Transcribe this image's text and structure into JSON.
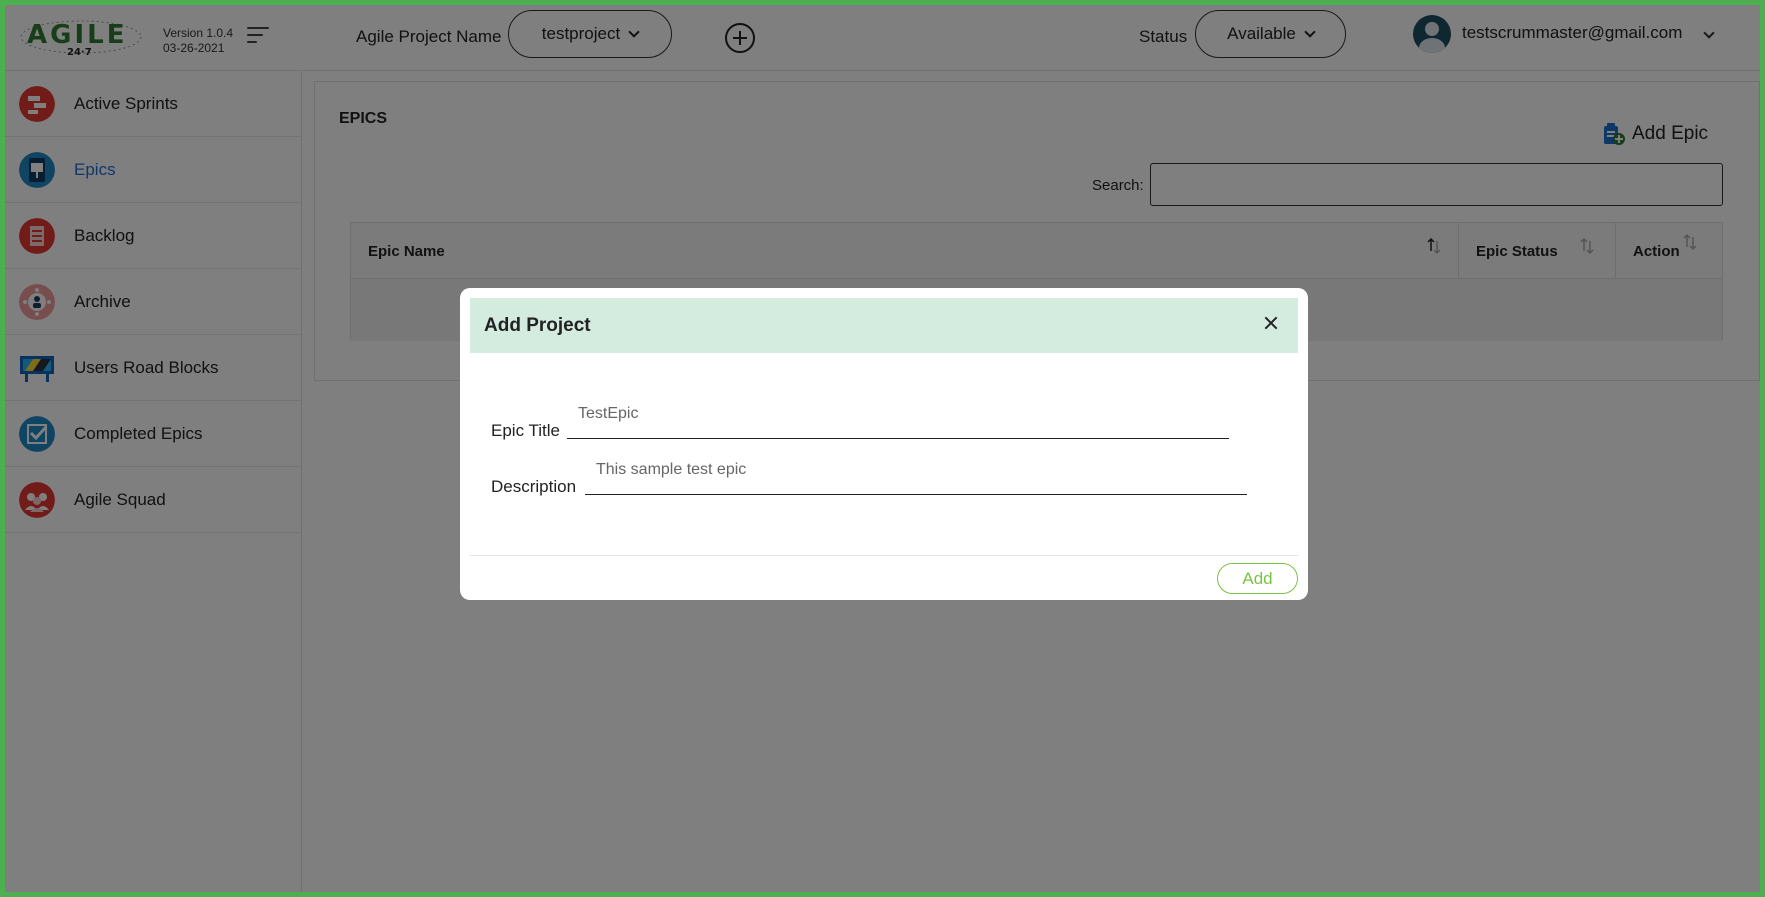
{
  "app": {
    "logo_text": "AGILE",
    "logo_sub": "24·7",
    "version": "Version 1.0.4",
    "date": "03-26-2021"
  },
  "header": {
    "project_label": "Agile Project Name",
    "project_value": "testproject",
    "status_label": "Status",
    "status_value": "Available",
    "user_email": "testscrummaster@gmail.com"
  },
  "sidebar": {
    "items": [
      {
        "label": "Active Sprints",
        "icon": "sprint-icon",
        "color": "#e53935"
      },
      {
        "label": "Epics",
        "icon": "presentation-icon",
        "color": "#1e88c7"
      },
      {
        "label": "Backlog",
        "icon": "list-icon",
        "color": "#e53935"
      },
      {
        "label": "Archive",
        "icon": "archive-icon",
        "color": "#e57373"
      },
      {
        "label": "Users Road Blocks",
        "icon": "roadblock-icon",
        "color": "#1e88c7"
      },
      {
        "label": "Completed Epics",
        "icon": "checkbox-icon",
        "color": "#1e88c7"
      },
      {
        "label": "Agile Squad",
        "icon": "team-icon",
        "color": "#e53935"
      }
    ],
    "active_index": 1
  },
  "main": {
    "title": "EPICS",
    "add_epic_label": "Add Epic",
    "search_label": "Search:",
    "search_value": "",
    "table": {
      "columns": [
        "Epic Name",
        "Epic Status",
        "Action"
      ],
      "rows": []
    }
  },
  "modal": {
    "title": "Add Project",
    "fields": [
      {
        "label": "Epic Title",
        "value": "TestEpic"
      },
      {
        "label": "Description",
        "value": "This sample test epic"
      }
    ],
    "submit_label": "Add"
  },
  "colors": {
    "accent_green": "#7cc242",
    "modal_header": "#d4ebe0",
    "active_link": "#1e6fd0"
  }
}
